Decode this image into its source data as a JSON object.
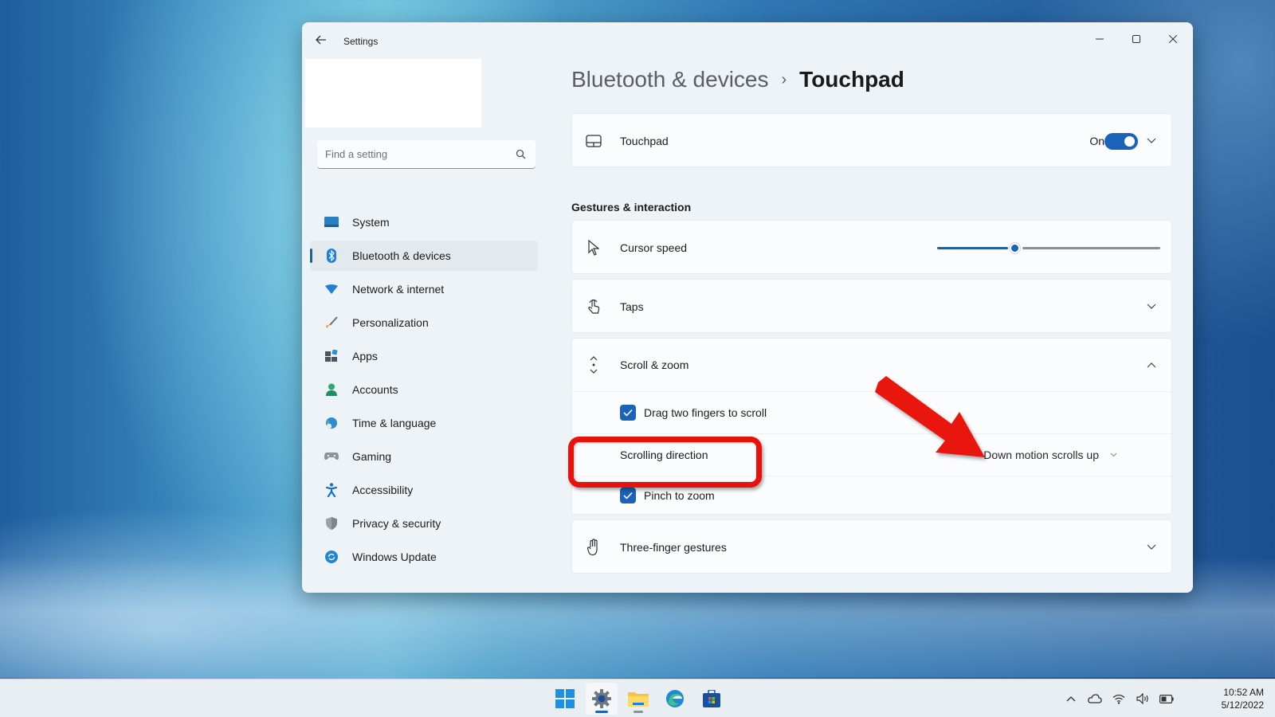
{
  "window": {
    "app_title": "Settings",
    "back_icon": "back-arrow-icon",
    "controls": {
      "minimize": "minimize-icon",
      "maximize": "maximize-icon",
      "close": "close-icon"
    }
  },
  "sidebar": {
    "search": {
      "placeholder": "Find a setting",
      "value": "",
      "icon": "search-icon"
    },
    "items": [
      {
        "label": "System",
        "icon": "system-icon",
        "active": false
      },
      {
        "label": "Bluetooth & devices",
        "icon": "bluetooth-icon",
        "active": true
      },
      {
        "label": "Network & internet",
        "icon": "wifi-icon",
        "active": false
      },
      {
        "label": "Personalization",
        "icon": "brush-icon",
        "active": false
      },
      {
        "label": "Apps",
        "icon": "apps-icon",
        "active": false
      },
      {
        "label": "Accounts",
        "icon": "person-icon",
        "active": false
      },
      {
        "label": "Time & language",
        "icon": "globe-clock-icon",
        "active": false
      },
      {
        "label": "Gaming",
        "icon": "gamepad-icon",
        "active": false
      },
      {
        "label": "Accessibility",
        "icon": "accessibility-icon",
        "active": false
      },
      {
        "label": "Privacy & security",
        "icon": "shield-icon",
        "active": false
      },
      {
        "label": "Windows Update",
        "icon": "update-icon",
        "active": false
      }
    ]
  },
  "breadcrumb": {
    "parent": "Bluetooth & devices",
    "separator": "›",
    "current": "Touchpad"
  },
  "touchpad": {
    "label": "Touchpad",
    "icon": "touchpad-icon",
    "toggle_text": "On",
    "toggle_on": true
  },
  "gestures": {
    "section_title": "Gestures & interaction",
    "cursor_speed": {
      "label": "Cursor speed",
      "icon": "cursor-icon",
      "value_percent": 35
    },
    "taps": {
      "label": "Taps",
      "icon": "tap-icon",
      "expanded": false
    },
    "scroll_zoom": {
      "label": "Scroll & zoom",
      "icon": "scroll-icon",
      "expanded": true,
      "drag_two_fingers": {
        "label": "Drag two fingers to scroll",
        "checked": true
      },
      "scrolling_direction": {
        "label": "Scrolling direction",
        "selected": "Down motion scrolls up"
      },
      "pinch_to_zoom": {
        "label": "Pinch to zoom",
        "checked": true
      }
    },
    "three_finger": {
      "label": "Three-finger gestures",
      "icon": "hand-icon",
      "expanded": false
    }
  },
  "annotation": {
    "highlight_color": "#e8120c",
    "arrow_color": "#e8120c"
  },
  "taskbar": {
    "apps": [
      {
        "name": "start",
        "icon": "windows-start-icon"
      },
      {
        "name": "settings",
        "icon": "settings-gear-icon"
      },
      {
        "name": "file-explorer",
        "icon": "folder-icon"
      },
      {
        "name": "edge",
        "icon": "edge-browser-icon"
      },
      {
        "name": "store",
        "icon": "store-icon"
      }
    ],
    "tray": [
      "chevron-up-icon",
      "onedrive-cloud-icon",
      "wifi-icon",
      "volume-icon",
      "battery-icon"
    ],
    "time": "10:52 AM",
    "date": "5/12/2022"
  },
  "colors": {
    "accent": "#1a63b8",
    "window_bg": "#eef3f8",
    "card_bg": "#fbfcfd"
  }
}
